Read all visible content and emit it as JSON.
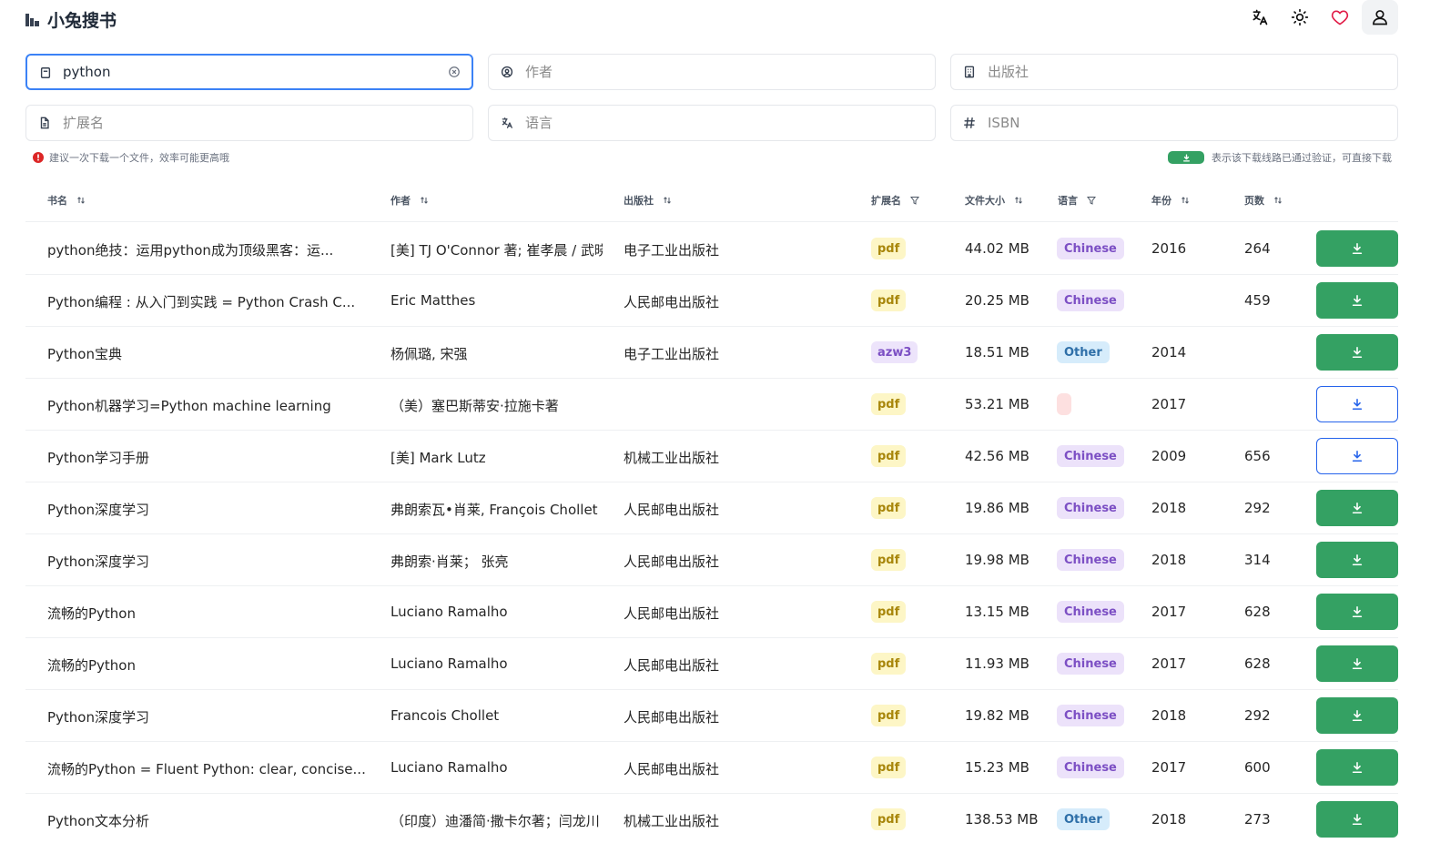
{
  "app": {
    "title": "小兔搜书"
  },
  "header": {
    "icons": [
      "translate-icon",
      "sun-icon",
      "heart-icon",
      "user-icon"
    ],
    "heart_color": "#e11d48"
  },
  "search": {
    "title_value": "python",
    "author_placeholder": "作者",
    "publisher_placeholder": "出版社",
    "extension_placeholder": "扩展名",
    "language_placeholder": "语言",
    "isbn_placeholder": "ISBN"
  },
  "tips": {
    "left": "建议一次下载一个文件，效率可能更高哦",
    "right": "表示该下载线路已通过验证，可直接下载"
  },
  "table": {
    "columns": {
      "title": "书名",
      "author": "作者",
      "publisher": "出版社",
      "extension": "扩展名",
      "size": "文件大小",
      "language": "语言",
      "year": "年份",
      "pages": "页数"
    },
    "rows": [
      {
        "title": "python绝技：运用python成为顶级黑客：运...",
        "author": "[美] TJ O'Connor 著; 崔孝晨 / 武晓音 等译",
        "publisher": "电子工业出版社",
        "ext": "pdf",
        "size": "44.02 MB",
        "lang": "Chinese",
        "year": "2016",
        "pages": "264",
        "verified": true
      },
      {
        "title": "Python编程 : 从入门到实践 = Python Crash C...",
        "author": "Eric Matthes",
        "publisher": "人民邮电出版社",
        "ext": "pdf",
        "size": "20.25 MB",
        "lang": "Chinese",
        "year": "",
        "pages": "459",
        "verified": true
      },
      {
        "title": "Python宝典",
        "author": "杨佩璐, 宋强",
        "publisher": "电子工业出版社",
        "ext": "azw3",
        "size": "18.51 MB",
        "lang": "Other",
        "year": "2014",
        "pages": "",
        "verified": true
      },
      {
        "title": "Python机器学习=Python machine learning",
        "author": "（美）塞巴斯蒂安·拉施卡著",
        "publisher": "",
        "ext": "pdf",
        "size": "53.21 MB",
        "lang": "",
        "year": "2017",
        "pages": "",
        "verified": false
      },
      {
        "title": "Python学习手册",
        "author": "[美] Mark Lutz",
        "publisher": "机械工业出版社",
        "ext": "pdf",
        "size": "42.56 MB",
        "lang": "Chinese",
        "year": "2009",
        "pages": "656",
        "verified": false
      },
      {
        "title": "Python深度学习",
        "author": "弗朗索瓦•肖莱, François Chollet",
        "publisher": "人民邮电出版社",
        "ext": "pdf",
        "size": "19.86 MB",
        "lang": "Chinese",
        "year": "2018",
        "pages": "292",
        "verified": true
      },
      {
        "title": "Python深度学习",
        "author": "弗朗索·肖莱；  张亮",
        "publisher": "人民邮电出版社",
        "ext": "pdf",
        "size": "19.98 MB",
        "lang": "Chinese",
        "year": "2018",
        "pages": "314",
        "verified": true
      },
      {
        "title": "流畅的Python",
        "author": "Luciano Ramalho",
        "publisher": "人民邮电出版社",
        "ext": "pdf",
        "size": "13.15 MB",
        "lang": "Chinese",
        "year": "2017",
        "pages": "628",
        "verified": true
      },
      {
        "title": "流畅的Python",
        "author": "Luciano Ramalho",
        "publisher": "人民邮电出版社",
        "ext": "pdf",
        "size": "11.93 MB",
        "lang": "Chinese",
        "year": "2017",
        "pages": "628",
        "verified": true
      },
      {
        "title": "Python深度学习",
        "author": "Francois Chollet",
        "publisher": "人民邮电出版社",
        "ext": "pdf",
        "size": "19.82 MB",
        "lang": "Chinese",
        "year": "2018",
        "pages": "292",
        "verified": true
      },
      {
        "title": "流畅的Python = Fluent Python: clear, concise...",
        "author": "Luciano Ramalho",
        "publisher": "人民邮电出版社",
        "ext": "pdf",
        "size": "15.23 MB",
        "lang": "Chinese",
        "year": "2017",
        "pages": "600",
        "verified": true
      },
      {
        "title": "Python文本分析",
        "author": "（印度）迪潘简·撒卡尔著；闫龙川",
        "publisher": "机械工业出版社",
        "ext": "pdf",
        "size": "138.53 MB",
        "lang": "Other",
        "year": "2018",
        "pages": "273",
        "verified": true
      }
    ]
  }
}
